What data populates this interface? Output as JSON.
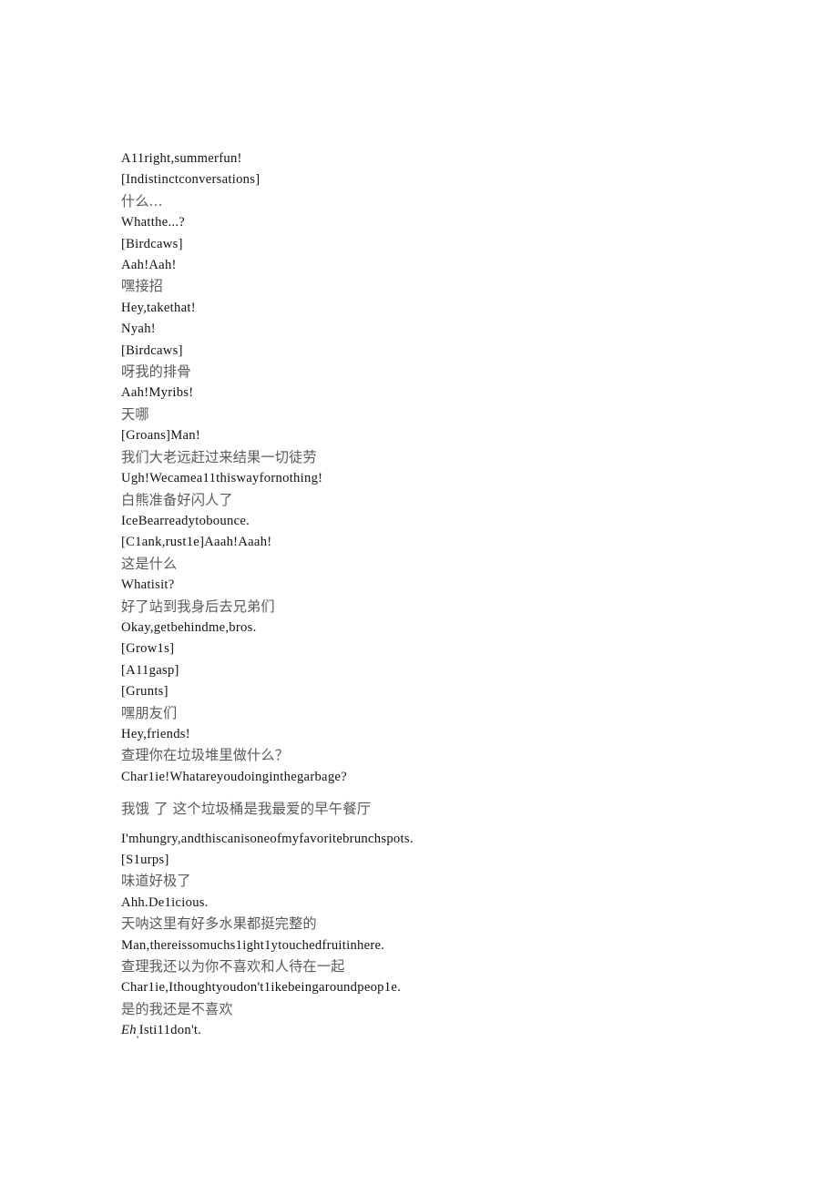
{
  "document": {
    "type": "bilingual-subtitle-transcript",
    "page_background": "#ffffff",
    "english_text_color": "#121212",
    "chinese_text_color": "#5a5a5a",
    "lines": [
      {
        "lang": "en",
        "text": "A11right,summerfun!"
      },
      {
        "lang": "en",
        "text": "[Indistinctconversations]"
      },
      {
        "lang": "zh",
        "text": "什么..."
      },
      {
        "lang": "en",
        "text": "Whatthe...?"
      },
      {
        "lang": "en",
        "text": "[Birdcaws]"
      },
      {
        "lang": "en",
        "text": "Aah!Aah!"
      },
      {
        "lang": "zh",
        "text": "嘿接招"
      },
      {
        "lang": "en",
        "text": "Hey,takethat!"
      },
      {
        "lang": "en",
        "text": "Nyah!"
      },
      {
        "lang": "en",
        "text": "[Birdcaws]"
      },
      {
        "lang": "zh",
        "text": "呀我的排骨"
      },
      {
        "lang": "en",
        "text": "Aah!Myribs!"
      },
      {
        "lang": "zh",
        "text": "天哪"
      },
      {
        "lang": "en",
        "text": "[Groans]Man!"
      },
      {
        "lang": "zh",
        "text": "我们大老远赶过来结果一切徒劳"
      },
      {
        "lang": "en",
        "text": "Ugh!Wecamea11thiswayfornothing!"
      },
      {
        "lang": "zh",
        "text": "白熊准备好闪人了"
      },
      {
        "lang": "en",
        "text": "IceBearreadytobounce."
      },
      {
        "lang": "en",
        "text": "[C1ank,rust1e]Aaah!Aaah!"
      },
      {
        "lang": "zh",
        "text": "这是什么"
      },
      {
        "lang": "en",
        "text": "Whatisit?"
      },
      {
        "lang": "zh",
        "text": "好了站到我身后去兄弟们"
      },
      {
        "lang": "en",
        "text": "Okay,getbehindme,bros."
      },
      {
        "lang": "en",
        "text": "[Grow1s]"
      },
      {
        "lang": "en",
        "text": "[A11gasp]"
      },
      {
        "lang": "en",
        "text": "[Grunts]"
      },
      {
        "lang": "zh",
        "text": "嘿朋友们"
      },
      {
        "lang": "en",
        "text": "Hey,friends!"
      },
      {
        "lang": "zh",
        "text": "查理你在垃圾堆里做什么？"
      },
      {
        "lang": "en",
        "text": "Char1ie!Whatareyoudoinginthegarbage?"
      },
      {
        "lang": "zh",
        "spaced": true,
        "text": "我饿 了 这个垃圾桶是我最爱的早午餐厅"
      },
      {
        "lang": "en",
        "text": "I'mhungry,andthiscanisoneofmyfavoritebrunchspots."
      },
      {
        "lang": "en",
        "text": "[S1urps]"
      },
      {
        "lang": "zh",
        "text": "味道好极了"
      },
      {
        "lang": "en",
        "text": "Ahh.De1icious."
      },
      {
        "lang": "zh",
        "text": "天呐这里有好多水果都挺完整的"
      },
      {
        "lang": "en",
        "text": "Man,thereissomuchs1ight1ytouchedfruitinhere."
      },
      {
        "lang": "zh",
        "text": "查理我还以为你不喜欢和人待在一起"
      },
      {
        "lang": "en",
        "text": "Char1ie,Ithoughtyoudon't1ikebeingaroundpeop1e."
      },
      {
        "lang": "zh",
        "text": "是的我还是不喜欢"
      },
      {
        "lang": "en",
        "italic_prefix": "Eh",
        "subscript_comma": ",",
        "text": "Isti11don't."
      }
    ]
  }
}
